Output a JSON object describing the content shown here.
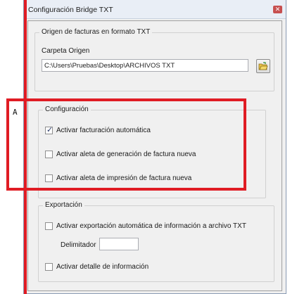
{
  "window": {
    "title": "Configuración Bridge TXT",
    "close_glyph": "✕"
  },
  "origin_group": {
    "title": "Origen de facturas en formato TXT",
    "folder_label": "Carpeta Origen",
    "folder_value": "C:\\Users\\Pruebas\\Desktop\\ARCHIVOS TXT",
    "browse_icon": "folder-browse-icon"
  },
  "config_group": {
    "title": "Configuración",
    "checkboxes": [
      {
        "label": "Activar facturación automática",
        "checked": true
      },
      {
        "label": "Activar aleta de generación de factura nueva",
        "checked": false
      },
      {
        "label": "Activar aleta de impresión de factura nueva",
        "checked": false
      }
    ]
  },
  "export_group": {
    "title": "Exportación",
    "auto_export_label": "Activar exportación automática de información a archivo TXT",
    "auto_export_checked": false,
    "delimiter_label": "Delimitador",
    "delimiter_value": "",
    "detail_label": "Activar detalle de información",
    "detail_checked": false
  },
  "annotation": {
    "marker": "A",
    "color": "#e01c24"
  }
}
